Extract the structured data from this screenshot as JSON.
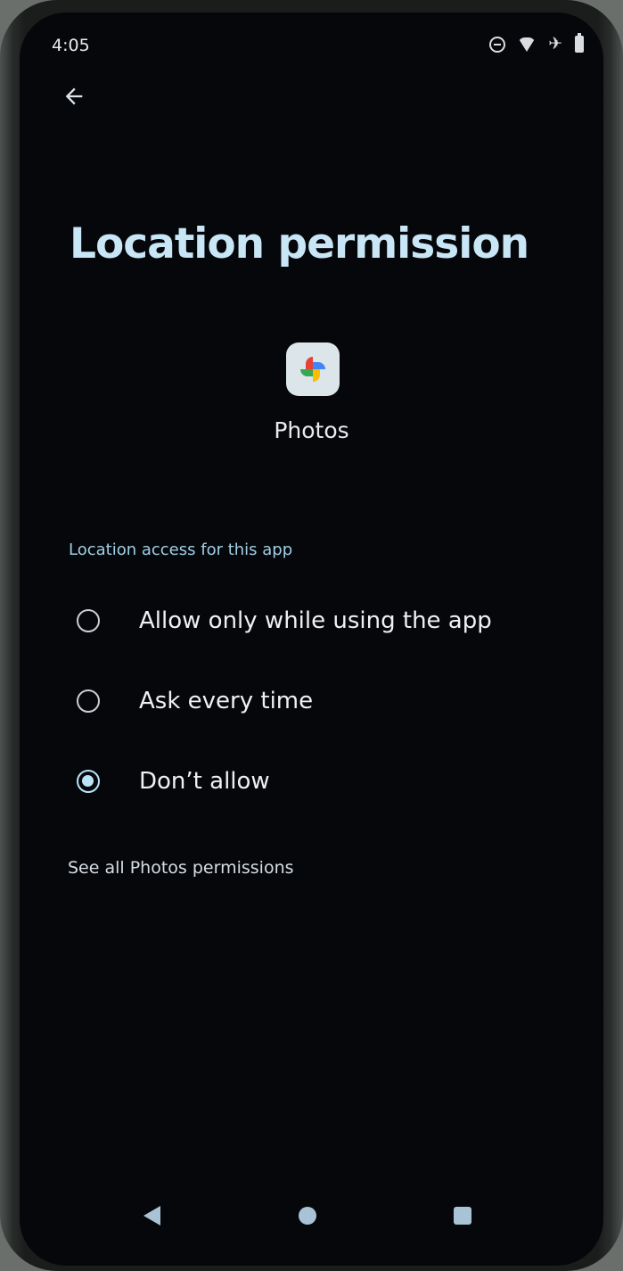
{
  "status_bar": {
    "time": "4:05",
    "icons": [
      "do-not-disturb-icon",
      "wifi-icon",
      "airplane-mode-icon",
      "battery-icon"
    ]
  },
  "toolbar": {
    "back_icon": "arrow-back-icon"
  },
  "page": {
    "title": "Location permission"
  },
  "app": {
    "icon": "photos-app-icon",
    "name": "Photos"
  },
  "permission_section": {
    "label": "Location access for this app",
    "options": [
      {
        "label": "Allow only while using the app",
        "selected": false
      },
      {
        "label": "Ask every time",
        "selected": false
      },
      {
        "label": "Don’t allow",
        "selected": true
      }
    ]
  },
  "link": {
    "label": "See all Photos permissions"
  },
  "nav_bar": {
    "buttons": [
      "nav-back-icon",
      "nav-home-icon",
      "nav-recents-icon"
    ]
  },
  "colors": {
    "background": "#06070a",
    "title": "#c8e6f5",
    "accent": "#b9e3f7",
    "section_label": "#9fd0e6"
  }
}
